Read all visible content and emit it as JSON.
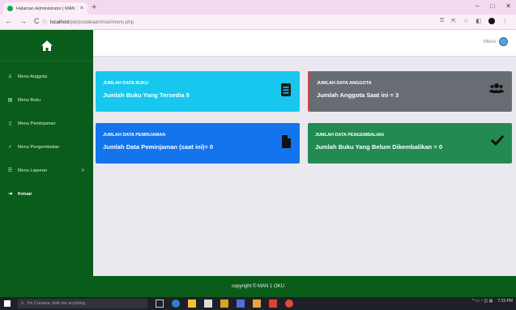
{
  "browser": {
    "tab_title": "Halaman Administrator | MAN 1",
    "tab_close": "×",
    "new_tab": "+",
    "url_host": "localhost",
    "url_path": "/perpustakaan/mainmenu.php",
    "nav": {
      "back": "←",
      "forward": "→",
      "reload": "C"
    },
    "window_controls": {
      "minimize": "–",
      "maximize": "□",
      "close": "✕"
    }
  },
  "sidebar": {
    "logo_icon": "home-icon",
    "items": [
      {
        "label": "Menu Anggota",
        "icon": "user-icon",
        "glyph": "♙"
      },
      {
        "label": "Menu Buku",
        "icon": "book-icon",
        "glyph": "▤"
      },
      {
        "label": "Menu Peminjaman",
        "icon": "file-icon",
        "glyph": "▯"
      },
      {
        "label": "Menu Pengembalian",
        "icon": "check-icon",
        "glyph": "✓"
      },
      {
        "label": "Menu Laporan",
        "icon": "list-icon",
        "glyph": "☰",
        "chevron": ">"
      },
      {
        "label": "Keluar",
        "icon": "logout-icon",
        "glyph": "⇥"
      }
    ]
  },
  "header": {
    "user_label": "Menu"
  },
  "cards": [
    {
      "label": "JUMLAH DATA BUKU",
      "text": "Jumlah Buku Yang Tersedia 5",
      "color": "#17c7ee",
      "icon": "book-icon"
    },
    {
      "label": "JUMLAH DATA ANGGOTA",
      "text": "Jumlah Anggota Saat ini = 3",
      "color": "#686c73",
      "icon": "users-icon"
    },
    {
      "label": "JUMLAH DATA PEMINJAMAN",
      "text": "Jumlah Data Peminjaman (saat ini)= 0",
      "color": "#1374ec",
      "icon": "file-icon"
    },
    {
      "label": "JUMLAH DATA PENGEMBALIAN",
      "text": "Jumlah Buku Yang Belum Dikembalikan = 0",
      "color": "#238a52",
      "icon": "check-icon"
    }
  ],
  "footer": {
    "text": "copyright © MAN 1 OKU"
  },
  "taskbar": {
    "search_placeholder": "I'm Cortana. Ask me anything.",
    "time": "7:15 PM"
  }
}
